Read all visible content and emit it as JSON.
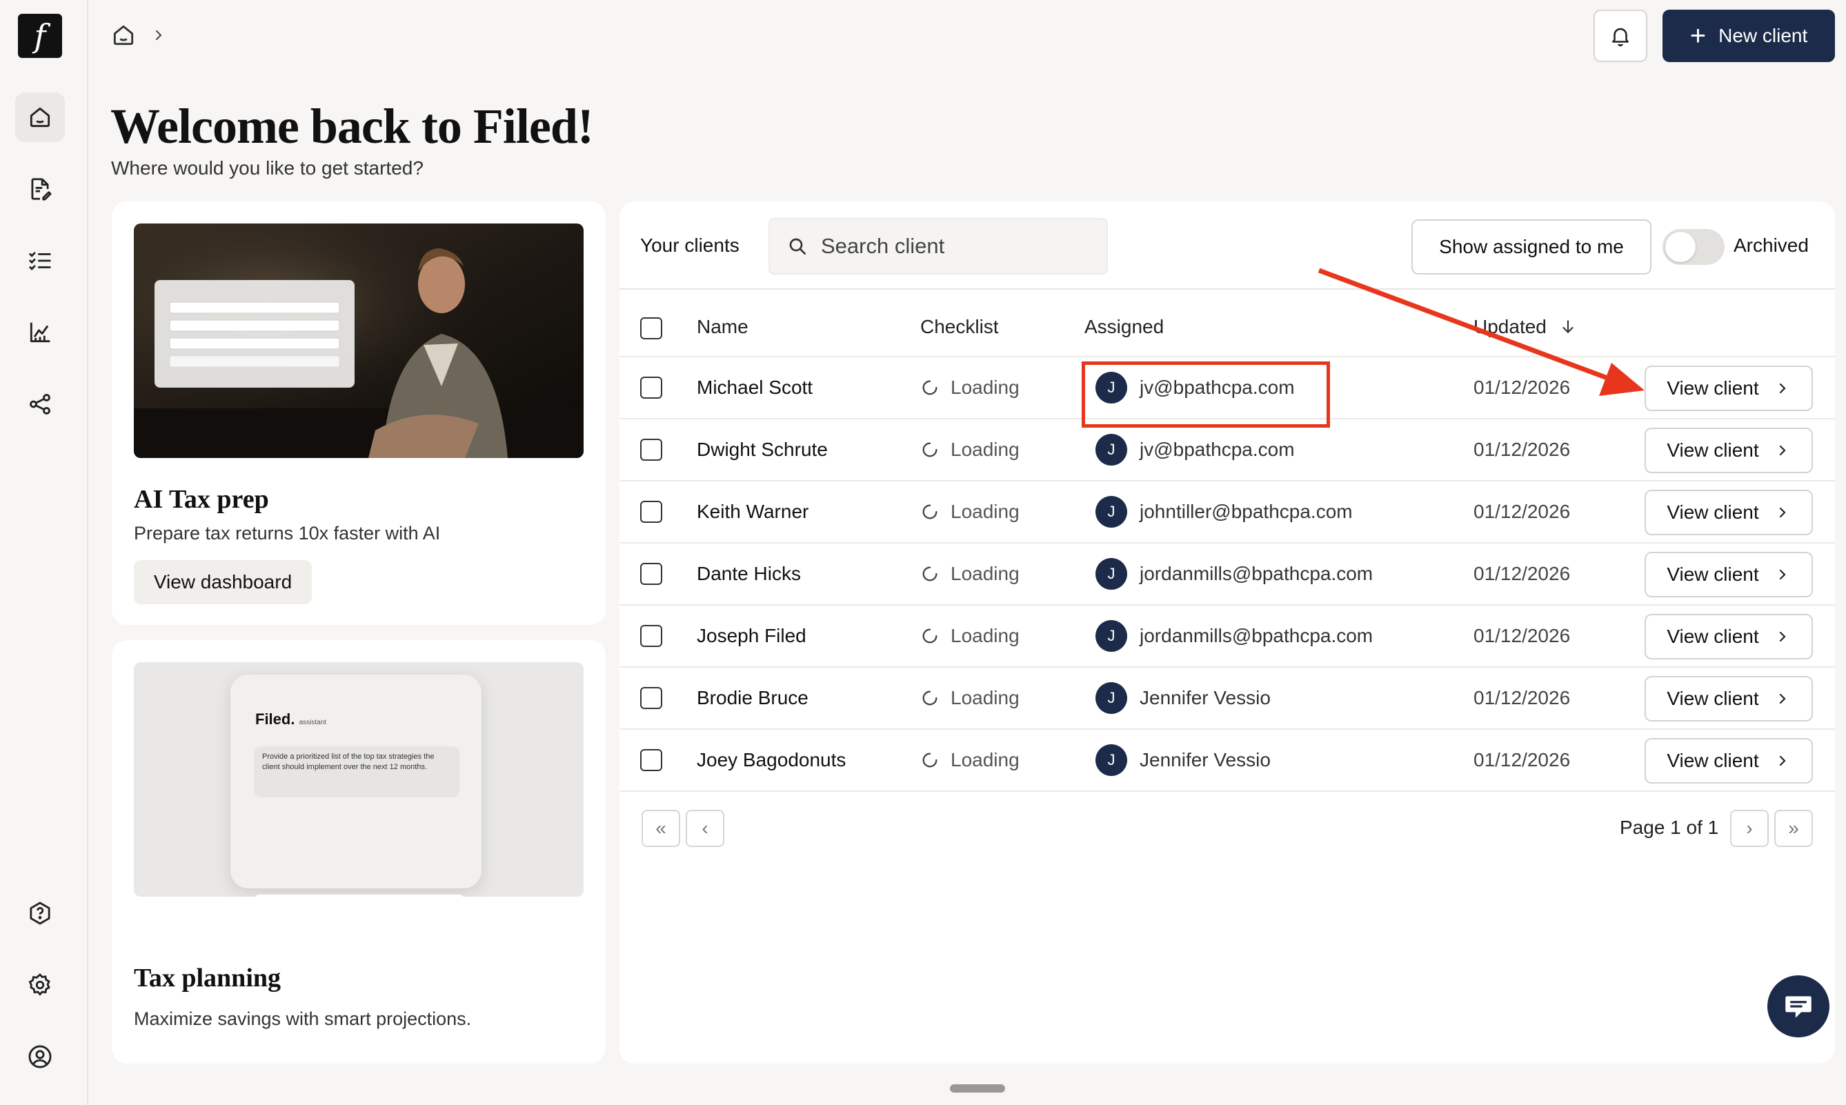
{
  "app": {
    "logo_letter": "f"
  },
  "sidebar": {
    "items": [
      {
        "icon": "home-icon",
        "active": true
      },
      {
        "icon": "document-edit-icon"
      },
      {
        "icon": "checklist-icon"
      },
      {
        "icon": "chart-icon"
      },
      {
        "icon": "share-icon"
      }
    ],
    "bottom": [
      "help-icon",
      "settings-icon",
      "profile-icon"
    ]
  },
  "topbar": {
    "new_client_label": "New client"
  },
  "welcome": {
    "title": "Welcome back to Filed!",
    "subtitle": "Where would you like to get started?"
  },
  "cards": {
    "tax_prep": {
      "title": "AI Tax prep",
      "desc": "Prepare tax returns 10x faster with AI",
      "button": "View dashboard"
    },
    "tax_planning": {
      "title": "Tax planning",
      "desc": "Maximize savings with smart projections.",
      "preview_brand": "Filed.",
      "preview_brand_suffix": "assistant",
      "preview_prompt": "Provide a prioritized list of the top tax strategies the client should implement over the next 12 months."
    }
  },
  "clients": {
    "heading": "Your clients",
    "search_placeholder": "Search client",
    "show_assigned_label": "Show assigned to me",
    "archived_label": "Archived",
    "archived_on": false,
    "columns": {
      "name": "Name",
      "checklist": "Checklist",
      "assigned": "Assigned",
      "updated": "Updated"
    },
    "view_label": "View client",
    "rows": [
      {
        "name": "Michael Scott",
        "checklist": "Loading",
        "initial": "J",
        "assigned": "jv@bpathcpa.com",
        "updated": "01/12/2026"
      },
      {
        "name": "Dwight Schrute",
        "checklist": "Loading",
        "initial": "J",
        "assigned": "jv@bpathcpa.com",
        "updated": "01/12/2026"
      },
      {
        "name": "Keith Warner",
        "checklist": "Loading",
        "initial": "J",
        "assigned": "johntiller@bpathcpa.com",
        "updated": "01/12/2026"
      },
      {
        "name": "Dante Hicks",
        "checklist": "Loading",
        "initial": "J",
        "assigned": "jordanmills@bpathcpa.com",
        "updated": "01/12/2026"
      },
      {
        "name": "Joseph Filed",
        "checklist": "Loading",
        "initial": "J",
        "assigned": "jordanmills@bpathcpa.com",
        "updated": "01/12/2026"
      },
      {
        "name": "Brodie Bruce",
        "checklist": "Loading",
        "initial": "J",
        "assigned": "Jennifer Vessio",
        "updated": "01/12/2026"
      },
      {
        "name": "Joey Bagodonuts",
        "checklist": "Loading",
        "initial": "J",
        "assigned": "Jennifer Vessio",
        "updated": "01/12/2026"
      }
    ],
    "pagination": {
      "label": "Page 1 of 1"
    }
  },
  "colors": {
    "accent": "#1b2b49",
    "annotation": "#e8361c",
    "background": "#f7f6f4"
  }
}
